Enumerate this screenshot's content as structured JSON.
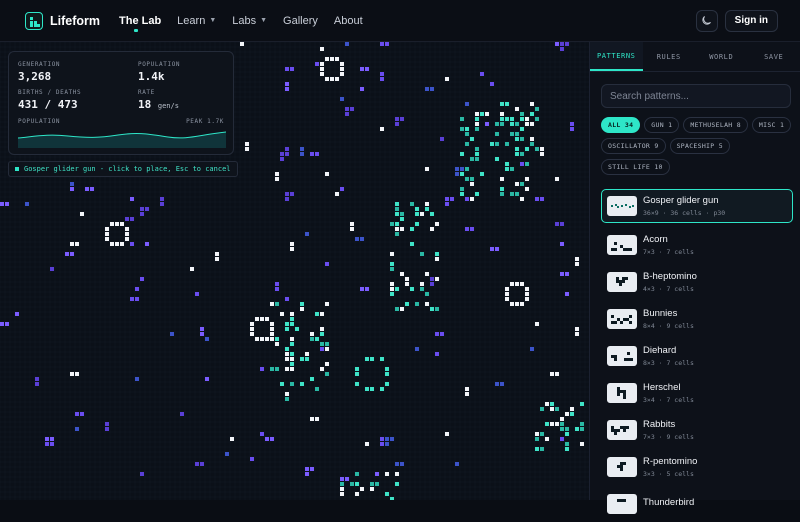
{
  "app": {
    "brand": "Lifeform"
  },
  "nav": {
    "items": [
      {
        "label": "The Lab",
        "active": true
      },
      {
        "label": "Learn",
        "dropdown": true
      },
      {
        "label": "Labs",
        "dropdown": true
      },
      {
        "label": "Gallery"
      },
      {
        "label": "About"
      }
    ],
    "theme_icon": "moon-icon",
    "signin_label": "Sign in"
  },
  "stats": {
    "generation_label": "GENERATION",
    "generation": "3,268",
    "population_label": "POPULATION",
    "population": "1.4k",
    "births_deaths_label": "BIRTHS / DEATHS",
    "births_deaths": "431 / 473",
    "rate_label": "RATE",
    "rate": "18",
    "rate_unit": "gen/s",
    "chart_label": "POPULATION",
    "peak_label": "PEAK 1.7K"
  },
  "hint": "Gosper glider gun - click to place, Esc to cancel",
  "panel": {
    "tabs": [
      {
        "label": "PATTERNS",
        "active": true
      },
      {
        "label": "RULES"
      },
      {
        "label": "WORLD"
      },
      {
        "label": "SAVE"
      }
    ],
    "search_placeholder": "Search patterns...",
    "chips": [
      {
        "label": "ALL 34",
        "active": true
      },
      {
        "label": "GUN 1"
      },
      {
        "label": "METHUSELAH 8"
      },
      {
        "label": "MISC 1"
      },
      {
        "label": "OSCILLATOR 9"
      },
      {
        "label": "SPACESHIP 5"
      },
      {
        "label": "STILL LIFE 10"
      }
    ],
    "patterns": [
      {
        "name": "Gosper glider gun",
        "meta": "36×9 · 36 cells · p30"
      },
      {
        "name": "Acorn",
        "meta": "7×3 · 7 cells"
      },
      {
        "name": "B-heptomino",
        "meta": "4×3 · 7 cells"
      },
      {
        "name": "Bunnies",
        "meta": "8×4 · 9 cells"
      },
      {
        "name": "Diehard",
        "meta": "8×3 · 7 cells"
      },
      {
        "name": "Herschel",
        "meta": "3×4 · 7 cells"
      },
      {
        "name": "Rabbits",
        "meta": "7×3 · 9 cells"
      },
      {
        "name": "R-pentomino",
        "meta": "3×3 · 5 cells"
      },
      {
        "name": "Thunderbird",
        "meta": ""
      }
    ]
  },
  "colors": {
    "accent": "#2ee6c8",
    "cell_purple": "#7b5cff",
    "cell_white": "#ffffff"
  }
}
